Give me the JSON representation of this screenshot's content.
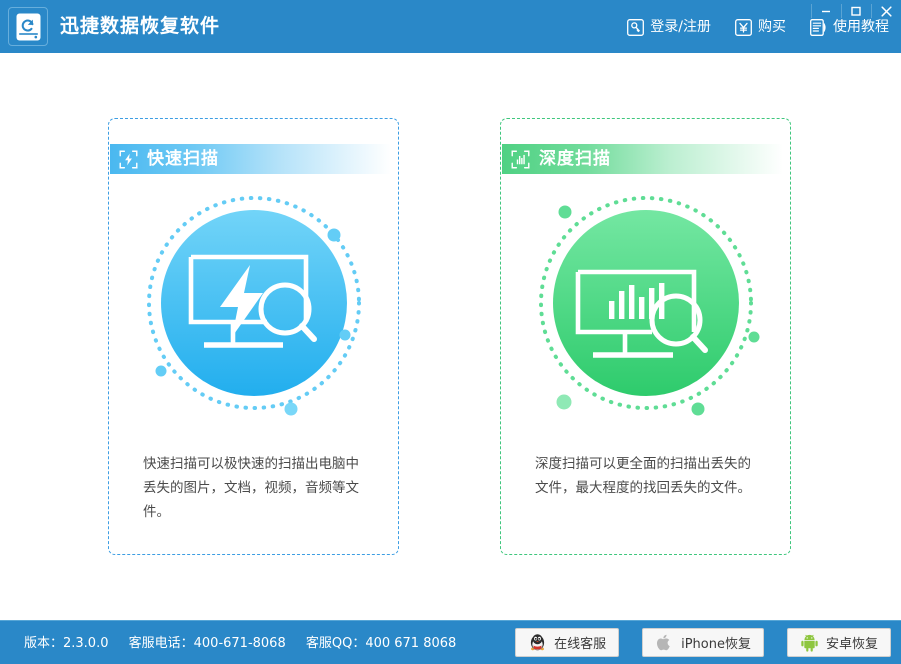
{
  "window": {
    "title": "迅捷数据恢复软件",
    "logo_icon": "hard-drive-restore-icon",
    "controls": {
      "minimize": "−",
      "maximize": "□",
      "close": "✕"
    }
  },
  "menu": [
    {
      "label": "登录/注册",
      "icon": "key-login-icon"
    },
    {
      "label": "购买",
      "icon": "yen-purchase-icon"
    },
    {
      "label": "使用教程",
      "icon": "document-tutorial-icon"
    }
  ],
  "cards": [
    {
      "id": "quick-scan",
      "title": "快速扫描",
      "head_icon": "bracket-lightning-icon",
      "art_icon": "monitor-lightning-magnifier-icon",
      "description": "快速扫描可以极快速的扫描出电脑中丢失的图片，文档，视频，音频等文件。",
      "accent": "#3d9ee3",
      "circle_top": "#6fd3f7",
      "circle_bottom": "#29b0ee"
    },
    {
      "id": "deep-scan",
      "title": "深度扫描",
      "head_icon": "bracket-barchart-icon",
      "art_icon": "monitor-barchart-magnifier-icon",
      "description": "深度扫描可以更全面的扫描出丢失的文件，最大程度的找回丢失的文件。",
      "accent": "#3fc77d",
      "circle_top": "#6ce49b",
      "circle_bottom": "#34cd70"
    }
  ],
  "footer": {
    "version_label": "版本：2.3.0.0",
    "phone_label": "客服电话：400-671-8068",
    "qq_label": "客服QQ：400 671 8068",
    "buttons": [
      {
        "label": "在线客服",
        "icon": "qq-penguin-icon"
      },
      {
        "label": "iPhone恢复",
        "icon": "apple-icon"
      },
      {
        "label": "安卓恢复",
        "icon": "android-robot-icon"
      }
    ]
  },
  "colors": {
    "header_blue": "#2a88c8",
    "footer_blue": "#2a88c8",
    "blue_accent": "#3d9ee3",
    "green_accent": "#3fc77d"
  }
}
